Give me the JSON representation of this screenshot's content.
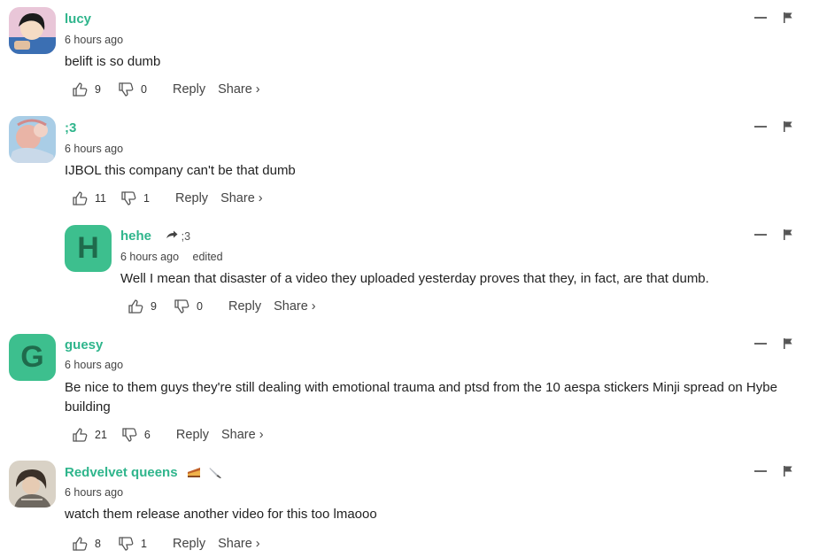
{
  "comments": [
    {
      "author": "lucy",
      "time": "6 hours ago",
      "text": "belift is so dumb",
      "likes": "9",
      "dislikes": "0",
      "reply_label": "Reply",
      "share_label": "Share ›"
    },
    {
      "author": ";3",
      "time": "6 hours ago",
      "text": "IJBOL this company can't be that dumb",
      "likes": "11",
      "dislikes": "1",
      "reply_label": "Reply",
      "share_label": "Share ›"
    },
    {
      "author": "hehe",
      "avatar_letter": "H",
      "reply_to": ";3",
      "time": "6 hours ago",
      "edited": "edited",
      "text": "Well I mean that disaster of a video they uploaded yesterday proves that they, in fact, are that dumb.",
      "likes": "9",
      "dislikes": "0",
      "reply_label": "Reply",
      "share_label": "Share ›"
    },
    {
      "author": "guesy",
      "avatar_letter": "G",
      "time": "6 hours ago",
      "text": "Be nice to them guys they're still dealing with emotional trauma and ptsd from the 10 aespa stickers Minji spread on Hybe building",
      "likes": "21",
      "dislikes": "6",
      "reply_label": "Reply",
      "share_label": "Share ›"
    },
    {
      "author": "Redvelvet queens",
      "time": "6 hours ago",
      "text": "watch them release another video for this too lmaooo",
      "likes": "8",
      "dislikes": "1",
      "reply_label": "Reply",
      "share_label": "Share ›"
    }
  ],
  "colors": {
    "accent": "#2fb58c",
    "avatar_green": "#3dbf8e"
  },
  "icons": {
    "like": "thumbs-up-icon",
    "dislike": "thumbs-down-icon",
    "collapse": "minus-icon",
    "report": "flag-icon",
    "reply_arrow": "reply-arrow-icon"
  }
}
